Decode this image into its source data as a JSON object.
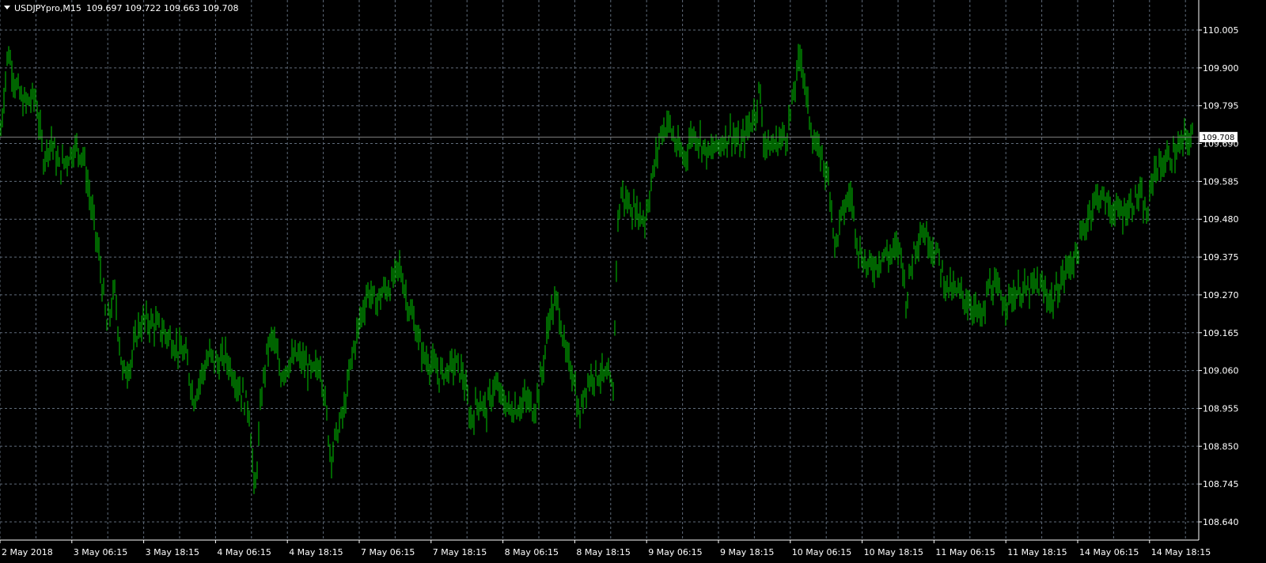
{
  "header": {
    "symbol_timeframe": "USDJPYpro,M15",
    "ohlc": "109.697 109.722 109.663 109.708"
  },
  "colors": {
    "background": "#000000",
    "grid": "#5f6b7a",
    "axis": "#ffffff",
    "bars": "#00c800",
    "price_line": "#7f7f7f"
  },
  "icons": {
    "menu": "triangle-down-icon"
  },
  "chart_data": {
    "type": "line",
    "title": "USDJPYpro,M15",
    "xlabel": "",
    "ylabel": "",
    "grid": true,
    "current_price": "109.708",
    "ylim": [
      108.6,
      110.06
    ],
    "y_ticks": [
      "110.005",
      "109.900",
      "109.795",
      "109.690",
      "109.585",
      "109.480",
      "109.375",
      "109.270",
      "109.165",
      "109.060",
      "108.955",
      "108.850",
      "108.745",
      "108.640"
    ],
    "x_ticks": [
      "2 May 2018",
      "3 May 06:15",
      "3 May 18:15",
      "4 May 06:15",
      "4 May 18:15",
      "7 May 06:15",
      "7 May 18:15",
      "8 May 06:15",
      "8 May 18:15",
      "9 May 06:15",
      "9 May 18:15",
      "10 May 06:15",
      "10 May 18:15",
      "11 May 06:15",
      "11 May 18:15",
      "14 May 06:15",
      "14 May 18:15"
    ],
    "series": [
      {
        "values": [
          [
            0,
            109.7
          ],
          [
            10,
            109.95
          ],
          [
            20,
            109.85
          ],
          [
            30,
            109.8
          ],
          [
            45,
            109.82
          ],
          [
            55,
            109.65
          ],
          [
            65,
            109.7
          ],
          [
            75,
            109.62
          ],
          [
            85,
            109.65
          ],
          [
            95,
            109.68
          ],
          [
            105,
            109.66
          ],
          [
            115,
            109.52
          ],
          [
            125,
            109.38
          ],
          [
            135,
            109.18
          ],
          [
            145,
            109.28
          ],
          [
            155,
            109.05
          ],
          [
            165,
            109.08
          ],
          [
            175,
            109.18
          ],
          [
            185,
            109.2
          ],
          [
            200,
            109.18
          ],
          [
            215,
            109.15
          ],
          [
            225,
            109.12
          ],
          [
            235,
            109.1
          ],
          [
            245,
            108.98
          ],
          [
            255,
            109.05
          ],
          [
            265,
            109.1
          ],
          [
            275,
            109.08
          ],
          [
            285,
            109.1
          ],
          [
            295,
            109.05
          ],
          [
            305,
            109.0
          ],
          [
            315,
            108.95
          ],
          [
            322,
            108.7
          ],
          [
            330,
            108.98
          ],
          [
            338,
            109.12
          ],
          [
            345,
            109.15
          ],
          [
            355,
            109.05
          ],
          [
            365,
            109.08
          ],
          [
            375,
            109.1
          ],
          [
            385,
            109.08
          ],
          [
            395,
            109.05
          ],
          [
            405,
            109.08
          ],
          [
            412,
            108.95
          ],
          [
            418,
            108.82
          ],
          [
            425,
            108.88
          ],
          [
            435,
            108.95
          ],
          [
            445,
            109.1
          ],
          [
            455,
            109.2
          ],
          [
            465,
            109.28
          ],
          [
            475,
            109.25
          ],
          [
            485,
            109.28
          ],
          [
            495,
            109.3
          ],
          [
            505,
            109.35
          ],
          [
            515,
            109.25
          ],
          [
            525,
            109.18
          ],
          [
            535,
            109.1
          ],
          [
            545,
            109.08
          ],
          [
            555,
            109.05
          ],
          [
            565,
            109.06
          ],
          [
            575,
            109.08
          ],
          [
            585,
            109.05
          ],
          [
            595,
            108.92
          ],
          [
            605,
            108.98
          ],
          [
            615,
            108.95
          ],
          [
            625,
            109.02
          ],
          [
            635,
            108.98
          ],
          [
            645,
            108.95
          ],
          [
            655,
            108.96
          ],
          [
            665,
            108.98
          ],
          [
            675,
            108.95
          ],
          [
            685,
            109.05
          ],
          [
            695,
            109.22
          ],
          [
            705,
            109.25
          ],
          [
            715,
            109.1
          ],
          [
            725,
            109.05
          ],
          [
            732,
            108.92
          ],
          [
            740,
            109.02
          ],
          [
            750,
            109.05
          ],
          [
            760,
            109.05
          ],
          [
            770,
            109.03
          ],
          [
            775,
            109.0
          ],
          [
            780,
            109.45
          ],
          [
            785,
            109.55
          ],
          [
            795,
            109.52
          ],
          [
            805,
            109.5
          ],
          [
            815,
            109.48
          ],
          [
            825,
            109.6
          ],
          [
            835,
            109.72
          ],
          [
            845,
            109.75
          ],
          [
            855,
            109.68
          ],
          [
            865,
            109.65
          ],
          [
            875,
            109.72
          ],
          [
            885,
            109.7
          ],
          [
            895,
            109.66
          ],
          [
            905,
            109.68
          ],
          [
            915,
            109.7
          ],
          [
            925,
            109.72
          ],
          [
            935,
            109.68
          ],
          [
            945,
            109.73
          ],
          [
            955,
            109.78
          ],
          [
            960,
            109.85
          ],
          [
            965,
            109.7
          ],
          [
            975,
            109.68
          ],
          [
            985,
            109.7
          ],
          [
            995,
            109.72
          ],
          [
            1005,
            109.85
          ],
          [
            1012,
            109.95
          ],
          [
            1020,
            109.8
          ],
          [
            1030,
            109.68
          ],
          [
            1040,
            109.65
          ],
          [
            1050,
            109.55
          ],
          [
            1055,
            109.4
          ],
          [
            1065,
            109.5
          ],
          [
            1075,
            109.55
          ],
          [
            1085,
            109.4
          ],
          [
            1095,
            109.35
          ],
          [
            1105,
            109.35
          ],
          [
            1115,
            109.38
          ],
          [
            1125,
            109.38
          ],
          [
            1135,
            109.4
          ],
          [
            1140,
            109.38
          ],
          [
            1145,
            109.25
          ],
          [
            1155,
            109.4
          ],
          [
            1165,
            109.45
          ],
          [
            1175,
            109.42
          ],
          [
            1185,
            109.38
          ],
          [
            1195,
            109.3
          ],
          [
            1205,
            109.28
          ],
          [
            1215,
            109.27
          ],
          [
            1225,
            109.25
          ],
          [
            1235,
            109.22
          ],
          [
            1242,
            109.2
          ],
          [
            1250,
            109.3
          ],
          [
            1260,
            109.28
          ],
          [
            1270,
            109.25
          ],
          [
            1280,
            109.27
          ],
          [
            1290,
            109.28
          ],
          [
            1300,
            109.28
          ],
          [
            1310,
            109.3
          ],
          [
            1320,
            109.28
          ],
          [
            1330,
            109.25
          ],
          [
            1340,
            109.3
          ],
          [
            1350,
            109.35
          ],
          [
            1360,
            109.38
          ],
          [
            1370,
            109.45
          ],
          [
            1380,
            109.52
          ],
          [
            1390,
            109.55
          ],
          [
            1400,
            109.52
          ],
          [
            1410,
            109.5
          ],
          [
            1420,
            109.5
          ],
          [
            1430,
            109.52
          ],
          [
            1440,
            109.55
          ],
          [
            1450,
            109.48
          ],
          [
            1458,
            109.62
          ],
          [
            1468,
            109.63
          ],
          [
            1478,
            109.65
          ],
          [
            1488,
            109.67
          ],
          [
            1498,
            109.7
          ],
          [
            1508,
            109.71
          ]
        ]
      }
    ]
  }
}
